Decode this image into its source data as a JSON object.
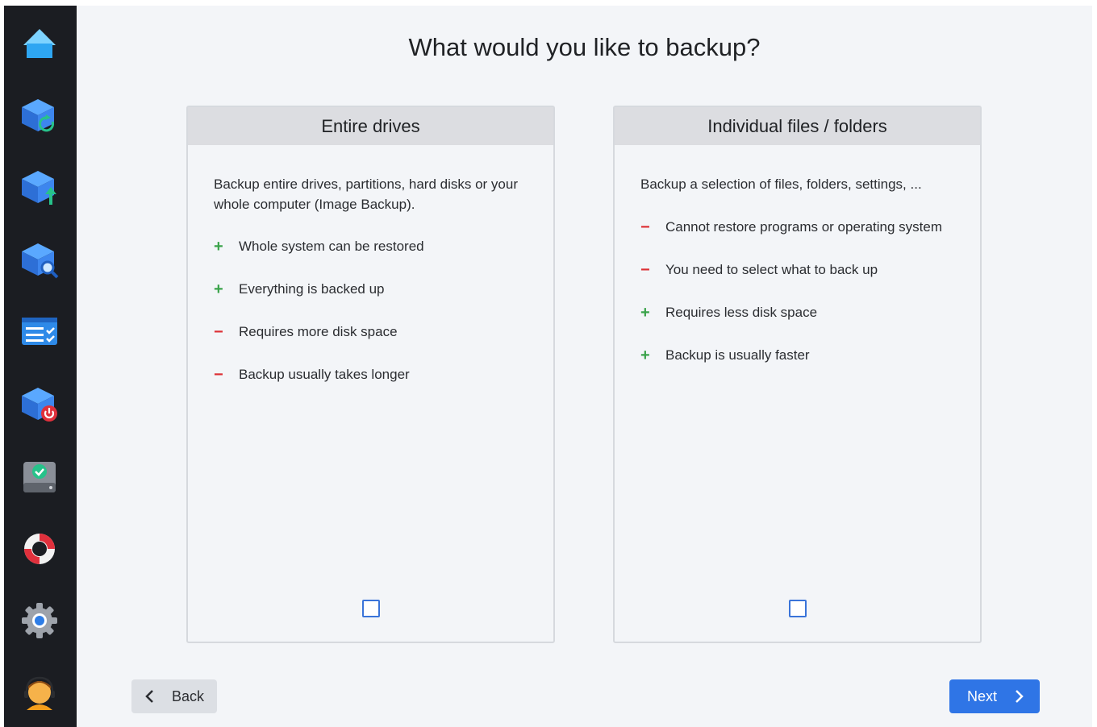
{
  "sidebar": {
    "items": [
      {
        "id": "home",
        "icon": "home-icon"
      },
      {
        "id": "restore",
        "icon": "restore-icon"
      },
      {
        "id": "backup",
        "icon": "backup-icon"
      },
      {
        "id": "explore",
        "icon": "explore-icon"
      },
      {
        "id": "tasks",
        "icon": "task-list-icon"
      },
      {
        "id": "shutdown",
        "icon": "shutdown-icon"
      },
      {
        "id": "drive-check",
        "icon": "drive-check-icon"
      },
      {
        "id": "help",
        "icon": "lifebuoy-icon"
      },
      {
        "id": "settings",
        "icon": "gear-icon"
      },
      {
        "id": "support",
        "icon": "support-avatar-icon"
      }
    ]
  },
  "main": {
    "title": "What would you like to backup?",
    "cards": [
      {
        "title": "Entire drives",
        "description": "Backup entire drives, partitions, hard disks or your whole computer (Image Backup).",
        "features": [
          {
            "sign": "+",
            "type": "pro",
            "text": "Whole system can be restored"
          },
          {
            "sign": "+",
            "type": "pro",
            "text": "Everything is backed up"
          },
          {
            "sign": "−",
            "type": "con",
            "text": "Requires more disk space"
          },
          {
            "sign": "−",
            "type": "con",
            "text": "Backup usually takes longer"
          }
        ],
        "checked": false
      },
      {
        "title": "Individual files / folders",
        "description": "Backup a selection of files, folders, settings, ...",
        "features": [
          {
            "sign": "−",
            "type": "con",
            "text": "Cannot restore programs or operating system"
          },
          {
            "sign": "−",
            "type": "con",
            "text": "You need to select what to back up"
          },
          {
            "sign": "+",
            "type": "pro",
            "text": "Requires less disk space"
          },
          {
            "sign": "+",
            "type": "pro",
            "text": "Backup is usually faster"
          }
        ],
        "checked": false
      }
    ]
  },
  "footer": {
    "back_label": "Back",
    "next_label": "Next"
  },
  "colors": {
    "accent": "#2f75e6",
    "pro": "#3aa34a",
    "con": "#dd3035",
    "sidebar_bg": "#1b1d22",
    "page_bg": "#f3f5f8"
  }
}
